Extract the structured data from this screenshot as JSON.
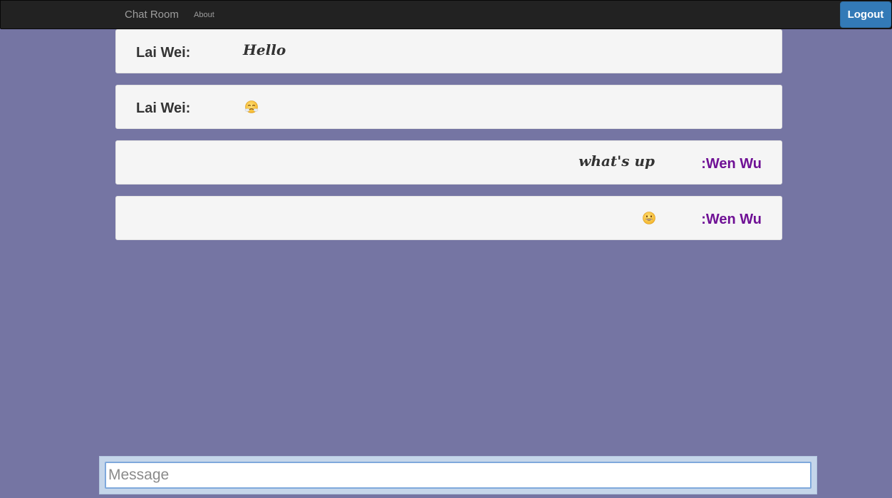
{
  "navbar": {
    "brand": "Chat Room",
    "links": [
      "About"
    ],
    "logout_label": "Logout"
  },
  "messages": [
    {
      "sender": "Lai Wei:",
      "text": "Hello",
      "side": "left"
    },
    {
      "sender": "Lai Wei:",
      "emoji": "face-with-steam-from-nose-emoji",
      "side": "left"
    },
    {
      "sender": ":Wen Wu",
      "text": "what's up",
      "side": "right"
    },
    {
      "sender": ":Wen Wu",
      "emoji": "grinning-face-emoji",
      "side": "right"
    }
  ],
  "composer": {
    "placeholder": "Message",
    "value": ""
  },
  "colors": {
    "page_background": "#7575a3",
    "navbar_background": "#222222",
    "primary_button": "#337ab7",
    "other_sender": "#6f1195"
  }
}
